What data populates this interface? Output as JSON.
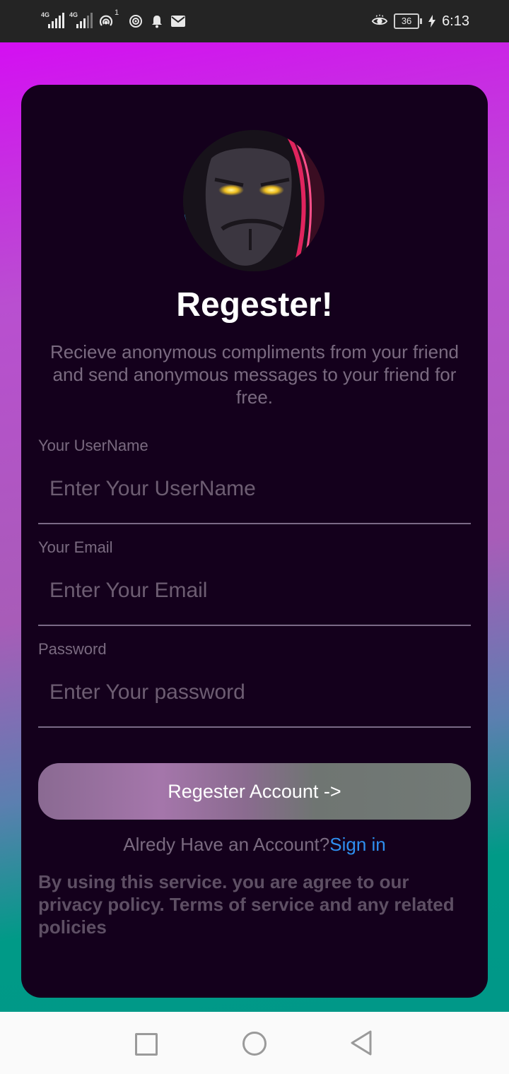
{
  "status_bar": {
    "sim1_tag": "4G",
    "sim2_tag": "4G",
    "hotspot_badge": "1",
    "battery": "36",
    "time": "6:13"
  },
  "form": {
    "title": "Regester!",
    "subtitle": "Recieve anonymous compliments from your friend and send anonymous messages to your friend for free.",
    "fields": [
      {
        "label": "Your UserName",
        "placeholder": "Enter Your UserName"
      },
      {
        "label": "Your Email",
        "placeholder": "Enter Your Email"
      },
      {
        "label": "Password",
        "placeholder": "Enter Your password"
      }
    ],
    "submit_label": "Regester Account ->",
    "signin_prompt": "Alredy Have an Account?",
    "signin_link": "Sign in",
    "terms": "By using this service. you are agree to our privacy policy. Terms of service and any related policies"
  },
  "colors": {
    "card_bg": "#14001c",
    "link": "#2f8ff0",
    "gradient_top": "#d40ff2",
    "gradient_bottom": "#009888"
  }
}
